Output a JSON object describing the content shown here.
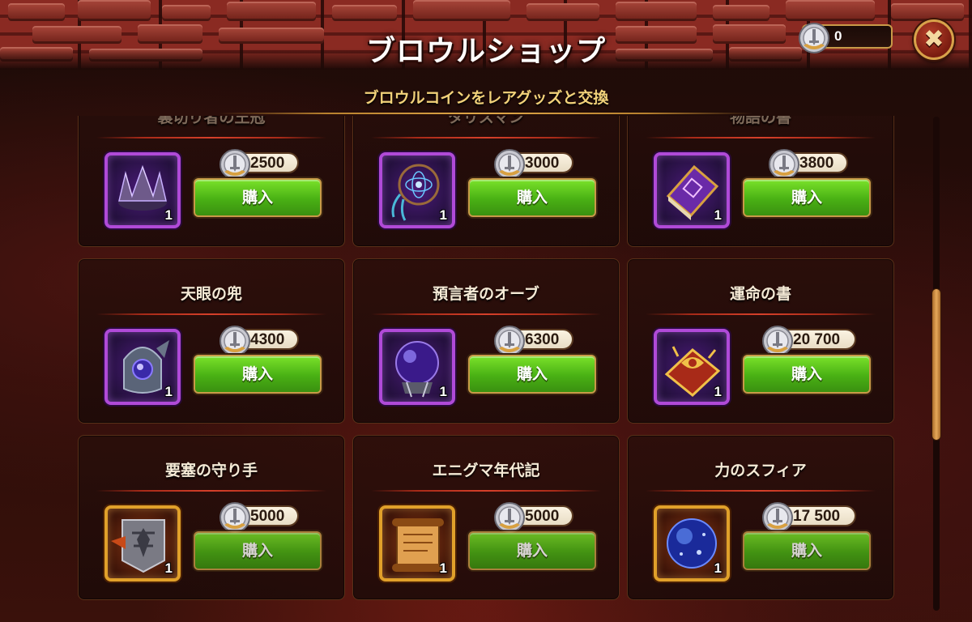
{
  "header": {
    "title": "ブロウルショップ",
    "subtitle": "ブロウルコインをレアグッズと交換",
    "currency_value": "0",
    "close_icon": "close-icon"
  },
  "colors": {
    "buy_button": "#49b014",
    "epic_frame": "#b04ad8",
    "legendary_frame": "#e0a02a",
    "subtitle": "#f2d27a"
  },
  "items": [
    {
      "name": "裏切り者の王冠",
      "price": "2500",
      "qty": "1",
      "rarity": "epic",
      "icon": "crown-icon",
      "buy": "購入"
    },
    {
      "name": "タリスマン",
      "price": "3000",
      "qty": "1",
      "rarity": "epic",
      "icon": "dreamcatcher-icon",
      "buy": "購入"
    },
    {
      "name": "物語の書",
      "price": "3800",
      "qty": "1",
      "rarity": "epic",
      "icon": "book-icon",
      "buy": "購入"
    },
    {
      "name": "天眼の兜",
      "price": "4300",
      "qty": "1",
      "rarity": "epic",
      "icon": "helmet-icon",
      "buy": "購入"
    },
    {
      "name": "預言者のオーブ",
      "price": "6300",
      "qty": "1",
      "rarity": "epic",
      "icon": "orb-icon",
      "buy": "購入"
    },
    {
      "name": "運命の書",
      "price": "20 700",
      "qty": "1",
      "rarity": "epic",
      "icon": "fate-book-icon",
      "buy": "購入"
    },
    {
      "name": "要塞の守り手",
      "price": "5000",
      "qty": "1",
      "rarity": "legendary",
      "icon": "banner-icon",
      "buy": "購入"
    },
    {
      "name": "エニグマ年代記",
      "price": "5000",
      "qty": "1",
      "rarity": "legendary",
      "icon": "scroll-icon",
      "buy": "購入"
    },
    {
      "name": "力のスフィア",
      "price": "17 500",
      "qty": "1",
      "rarity": "legendary",
      "icon": "sphere-icon",
      "buy": "購入"
    }
  ],
  "scroll": {
    "position_fraction": 0.45
  }
}
